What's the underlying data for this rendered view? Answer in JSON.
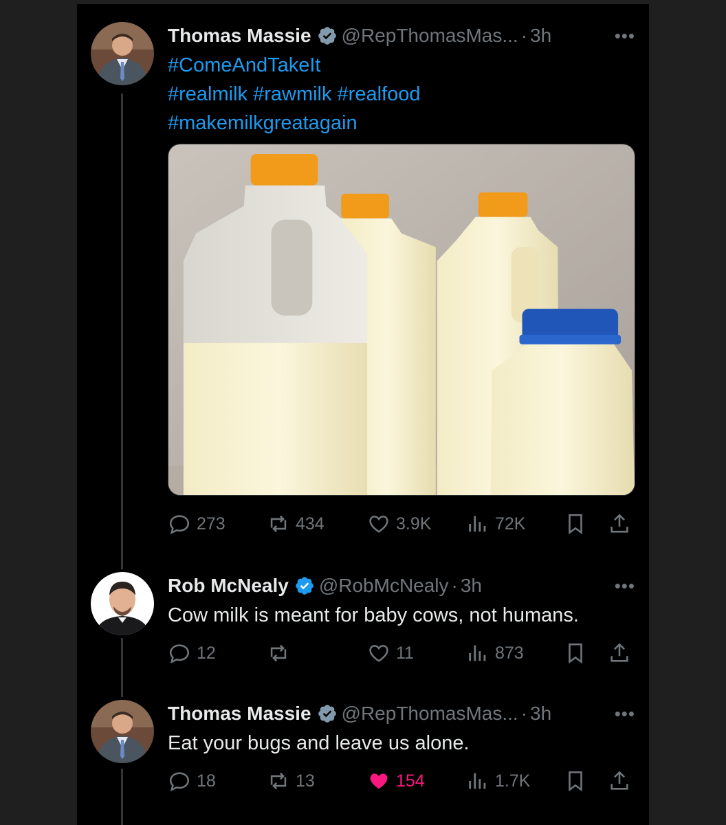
{
  "tweets": [
    {
      "author": "Thomas Massie",
      "handle": "@RepThomasMas...",
      "time": "3h",
      "more": "•••",
      "lines": [
        "#ComeAndTakeIt",
        "#realmilk #rawmilk #realfood",
        "#makemilkgreatagain"
      ],
      "stats": {
        "replies": "273",
        "reposts": "434",
        "likes": "3.9K",
        "views": "72K"
      },
      "liked": false
    },
    {
      "author": "Rob McNealy",
      "handle": "@RobMcNealy",
      "time": "3h",
      "more": "•••",
      "lines": [
        "Cow milk is meant for baby cows, not humans."
      ],
      "stats": {
        "replies": "12",
        "reposts": "",
        "likes": "11",
        "views": "873"
      },
      "liked": false
    },
    {
      "author": "Thomas Massie",
      "handle": "@RepThomasMas...",
      "time": "3h",
      "more": "•••",
      "lines": [
        "Eat your bugs and leave us alone."
      ],
      "stats": {
        "replies": "18",
        "reposts": "13",
        "likes": "154",
        "views": "1.7K"
      },
      "liked": true
    }
  ],
  "colors": {
    "background": "#000000",
    "link": "#1d9bf0",
    "muted": "#71767b",
    "like": "#f91880",
    "verified_blue": "#1d9bf0",
    "verified_gray": "#829aab"
  },
  "icons": [
    "reply-icon",
    "repost-icon",
    "like-icon",
    "views-icon",
    "bookmark-icon",
    "share-icon",
    "verified-icon"
  ]
}
